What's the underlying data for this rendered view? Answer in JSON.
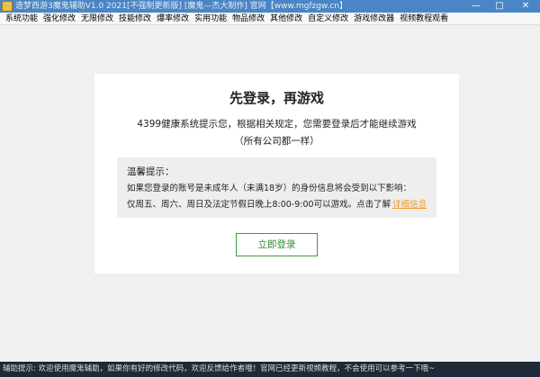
{
  "window": {
    "title": "造梦西游3魔鬼辅助V1.0 2021[不强制更新版]    [魔鬼—杰大制作]    官网【www.mgfzgw.cn】",
    "minimize_label": "—",
    "maximize_label": "□",
    "close_label": "✕"
  },
  "menu": {
    "items": [
      {
        "label": "系统功能"
      },
      {
        "label": "强化修改"
      },
      {
        "label": "无限修改"
      },
      {
        "label": "技能修改"
      },
      {
        "label": "爆率修改"
      },
      {
        "label": "实用功能"
      },
      {
        "label": "物品修改"
      },
      {
        "label": "其他修改"
      },
      {
        "label": "自定义修改"
      },
      {
        "label": "游戏修改器"
      },
      {
        "label": "视频教程观看"
      }
    ]
  },
  "notice": {
    "title": "先登录，再游戏",
    "line1": "4399健康系统提示您，根据相关规定，您需要登录后才能继续游戏",
    "line2": "（所有公司都一样）",
    "tips": {
      "title": "温馨提示：",
      "text1": "如果您登录的账号是未成年人（未满18岁）的身份信息将会受到以下影响：",
      "text2": "仅周五、周六、周日及法定节假日晚上8:00-9:00可以游戏。点击了解",
      "link": "详细信息"
    },
    "login_button": "立即登录"
  },
  "status": {
    "text": "辅助提示: 欢迎使用魔鬼辅助，如果你有好的修改代码，欢迎反馈给作者哦！官网已经更新视频教程，不会使用可以参考一下哦~"
  },
  "colors": {
    "title_bar": "#4a86c5",
    "status_bar": "#1f2a38",
    "login_button_border": "#3a9c3a",
    "link": "#f39a1e"
  }
}
